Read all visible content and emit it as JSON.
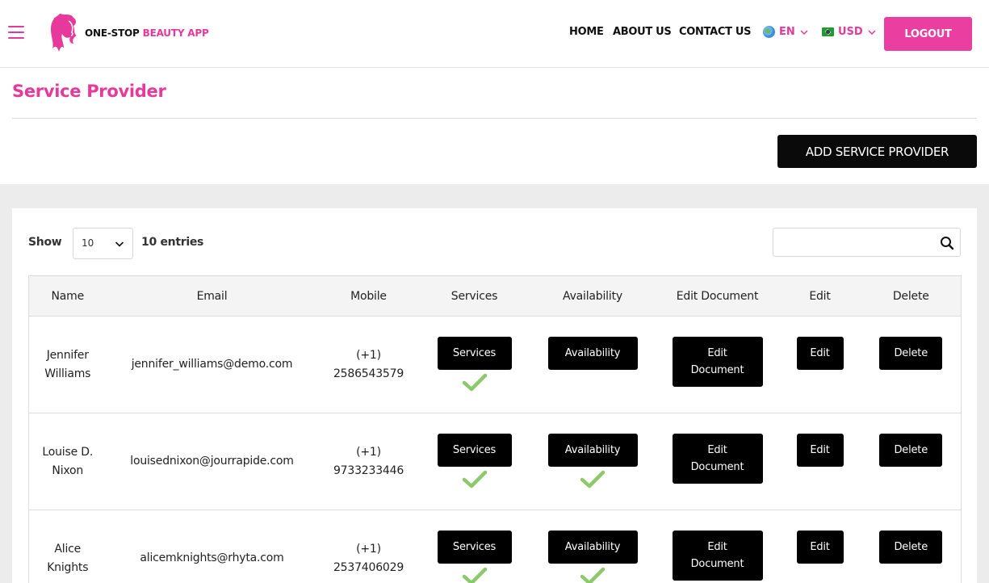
{
  "header": {
    "brand_part1": "ONE-STOP ",
    "brand_part2": "BEAUTY APP",
    "nav": {
      "home": "HOME",
      "about": "ABOUT US",
      "contact": "CONTACT US"
    },
    "language": "EN",
    "currency": "USD",
    "logout_label": "LOGOUT"
  },
  "page": {
    "title": "Service Provider",
    "add_button_label": "ADD SERVICE PROVIDER"
  },
  "table_controls": {
    "show_label": "Show",
    "page_size": "10",
    "entries_label": "10 entries",
    "search_value": ""
  },
  "table": {
    "columns": [
      "Name",
      "Email",
      "Mobile",
      "Services",
      "Availability",
      "Edit Document",
      "Edit",
      "Delete"
    ],
    "rows": [
      {
        "name_line1": "Jennifer",
        "name_line2": "Williams",
        "email": "jennifer_williams@demo.com",
        "mobile_line1": "(+1)",
        "mobile_line2": "2586543579",
        "services_label": "Services",
        "availability_label": "Availability",
        "edit_document_line1": "Edit",
        "edit_document_line2": "Document",
        "edit_label": "Edit",
        "delete_label": "Delete"
      },
      {
        "name_line1": "Louise D.",
        "name_line2": "Nixon",
        "email": "louisednixon@jourrapide.com",
        "mobile_line1": "(+1)",
        "mobile_line2": "9733233446",
        "services_label": "Services",
        "availability_label": "Availability",
        "edit_document_line1": "Edit",
        "edit_document_line2": "Document",
        "edit_label": "Edit",
        "delete_label": "Delete"
      },
      {
        "name_line1": "Alice",
        "name_line2": "Knights",
        "email": "alicemknights@rhyta.com",
        "mobile_line1": "(+1)",
        "mobile_line2": "2537406029",
        "services_label": "Services",
        "availability_label": "Availability",
        "edit_document_line1": "Edit",
        "edit_document_line2": "Document",
        "edit_label": "Edit",
        "delete_label": "Delete"
      }
    ]
  },
  "colors": {
    "accent": "#e6399b",
    "check": "#8cc96a",
    "button": "#000000"
  },
  "icons": {
    "menu": "hamburger-icon",
    "logo": "woman-silhouette-logo",
    "language": "globe-icon",
    "currency": "brazil-flag-icon",
    "dropdown": "chevron-down-icon",
    "search": "search-icon",
    "status": "checkmark-icon"
  }
}
